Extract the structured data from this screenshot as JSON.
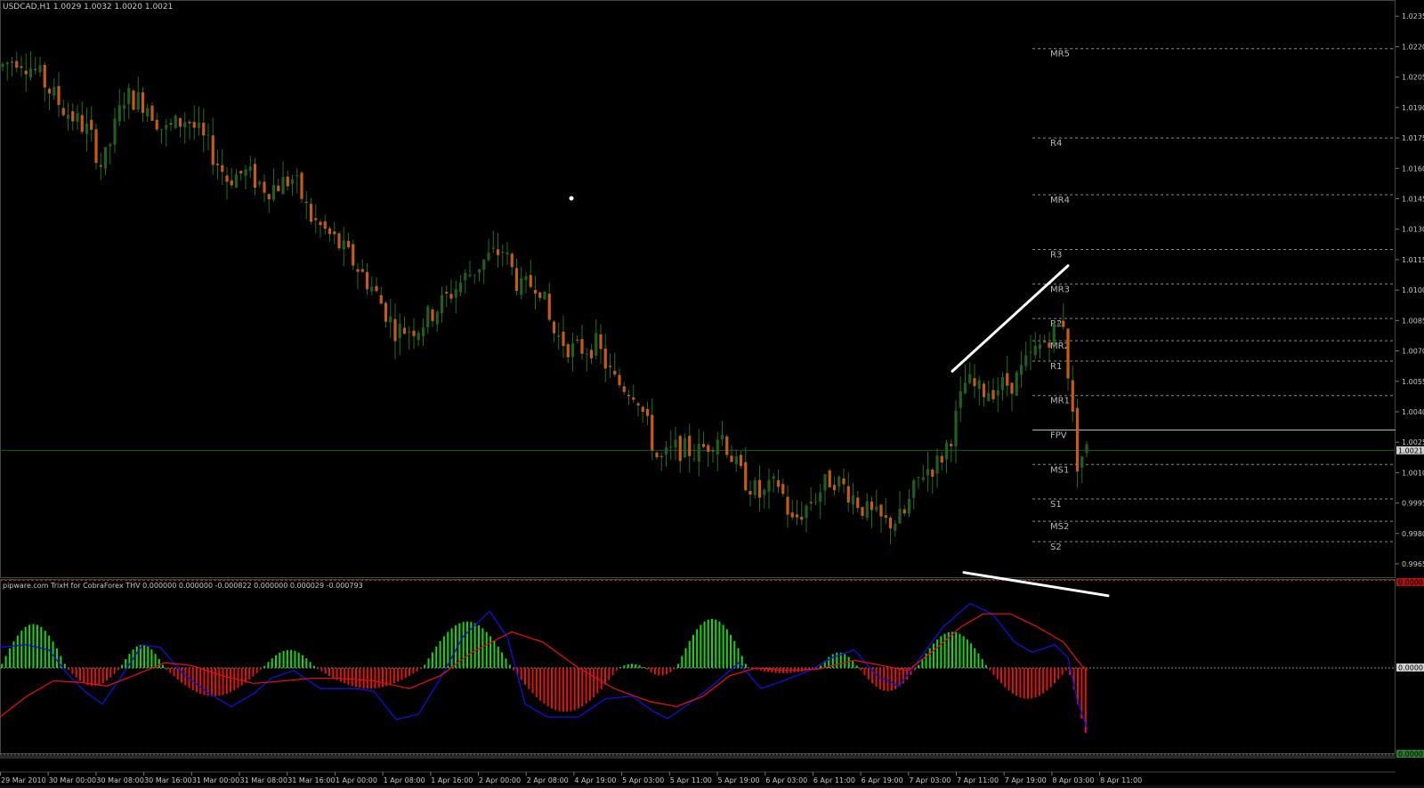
{
  "main_chart": {
    "symbol_header": "USDCAD,H1  1.0029 1.0032 1.0020 1.0021",
    "current_price_label": "1.0021",
    "price_scale": [
      "1.0235",
      "1.0220",
      "1.0205",
      "1.0190",
      "1.0175",
      "1.0160",
      "1.0145",
      "1.0130",
      "1.0115",
      "1.0100",
      "1.0085",
      "1.0070",
      "1.0055",
      "1.0040",
      "1.0025",
      "1.0010",
      "0.9995",
      "0.9980",
      "0.9965"
    ],
    "pivot_levels": [
      {
        "label": "MR5",
        "price": 1.0219
      },
      {
        "label": "R4",
        "price": 1.0175
      },
      {
        "label": "MR4",
        "price": 1.0147
      },
      {
        "label": "R3",
        "price": 1.012
      },
      {
        "label": "MR3",
        "price": 1.0103
      },
      {
        "label": "R2",
        "price": 1.0086
      },
      {
        "label": "MR2",
        "price": 1.0075
      },
      {
        "label": "R1",
        "price": 1.0065
      },
      {
        "label": "MR1",
        "price": 1.0048
      },
      {
        "label": "FPV",
        "price": 1.0031
      },
      {
        "label": "MS1",
        "price": 1.0014
      },
      {
        "label": "S1",
        "price": 0.9997
      },
      {
        "label": "MS2",
        "price": 0.9986
      },
      {
        "label": "S2",
        "price": 0.9976
      }
    ]
  },
  "indicator": {
    "header": "pipware.com TrixH for CobraForex THV 0.000000 0.000000 -0.000822 0.000000 0.000029 -0.000793",
    "zero_label": "0.0000",
    "top_label": "0.0000",
    "bottom_label": "0.0000"
  },
  "time_axis": [
    "29 Mar 2010",
    "30 Mar 00:00",
    "30 Mar 08:00",
    "30 Mar 16:00",
    "31 Mar 00:00",
    "31 Mar 08:00",
    "31 Mar 16:00",
    "1 Apr 00:00",
    "1 Apr 08:00",
    "1 Apr 16:00",
    "2 Apr 00:00",
    "2 Apr 08:00",
    "4 Apr 19:00",
    "5 Apr 03:00",
    "5 Apr 11:00",
    "5 Apr 19:00",
    "6 Apr 03:00",
    "6 Apr 11:00",
    "6 Apr 19:00",
    "7 Apr 03:00",
    "7 Apr 11:00",
    "7 Apr 19:00",
    "8 Apr 03:00",
    "8 Apr 11:00"
  ],
  "chart_data": {
    "type": "candlestick",
    "symbol": "USDCAD",
    "timeframe": "H1",
    "last_bar": {
      "open": 1.0029,
      "high": 1.0032,
      "low": 1.002,
      "close": 1.0021
    },
    "y_range": [
      0.9958,
      1.0243
    ],
    "close_path": [
      [
        0,
        1.021
      ],
      [
        20,
        1.0215
      ],
      [
        40,
        1.0208
      ],
      [
        70,
        1.019
      ],
      [
        100,
        1.0178
      ],
      [
        115,
        1.016
      ],
      [
        140,
        1.0196
      ],
      [
        165,
        1.0192
      ],
      [
        185,
        1.0178
      ],
      [
        210,
        1.0185
      ],
      [
        235,
        1.017
      ],
      [
        255,
        1.0155
      ],
      [
        275,
        1.0158
      ],
      [
        300,
        1.015
      ],
      [
        330,
        1.0155
      ],
      [
        350,
        1.0135
      ],
      [
        375,
        1.0125
      ],
      [
        395,
        1.0115
      ],
      [
        420,
        1.01
      ],
      [
        445,
        1.008
      ],
      [
        470,
        1.0082
      ],
      [
        495,
        1.0093
      ],
      [
        520,
        1.0105
      ],
      [
        545,
        1.0115
      ],
      [
        565,
        1.012
      ],
      [
        585,
        1.01
      ],
      [
        605,
        1.0105
      ],
      [
        620,
        1.008
      ],
      [
        645,
        1.007
      ],
      [
        670,
        1.0073
      ],
      [
        690,
        1.0055
      ],
      [
        715,
        1.005
      ],
      [
        740,
        1.0015
      ],
      [
        760,
        1.0022
      ],
      [
        785,
        1.002
      ],
      [
        810,
        1.003
      ],
      [
        830,
        1.001
      ],
      [
        855,
        0.9998
      ],
      [
        875,
        1.0005
      ],
      [
        890,
        0.9985
      ],
      [
        915,
        0.9998
      ],
      [
        935,
        1.0008
      ],
      [
        955,
        1.0
      ],
      [
        975,
        0.999
      ],
      [
        995,
        0.9985
      ],
      [
        1015,
        0.9988
      ],
      [
        1035,
        1.001
      ],
      [
        1055,
        1.0015
      ],
      [
        1070,
        1.003
      ],
      [
        1085,
        1.0055
      ],
      [
        1100,
        1.005
      ],
      [
        1120,
        1.0052
      ],
      [
        1140,
        1.0055
      ],
      [
        1160,
        1.0068
      ],
      [
        1180,
        1.0078
      ],
      [
        1195,
        1.0085
      ],
      [
        1200,
        1.006
      ],
      [
        1210,
        1.0015
      ],
      [
        1220,
        1.0021
      ]
    ],
    "trendlines": [
      {
        "from": [
          1070,
          1.006
        ],
        "to": [
          1200,
          1.0112
        ]
      }
    ],
    "indicator_bars": [
      {
        "from": 0,
        "to": 75,
        "peak": 0.85,
        "sign": "positive"
      },
      {
        "from": 75,
        "to": 135,
        "peak": -0.35,
        "sign": "negative"
      },
      {
        "from": 135,
        "to": 185,
        "peak": 0.45,
        "sign": "positive"
      },
      {
        "from": 185,
        "to": 295,
        "peak": -0.55,
        "sign": "negative"
      },
      {
        "from": 295,
        "to": 355,
        "peak": 0.35,
        "sign": "positive"
      },
      {
        "from": 355,
        "to": 475,
        "peak": -0.4,
        "sign": "negative"
      },
      {
        "from": 475,
        "to": 575,
        "peak": 0.9,
        "sign": "positive"
      },
      {
        "from": 575,
        "to": 695,
        "peak": -0.85,
        "sign": "negative"
      },
      {
        "from": 695,
        "to": 725,
        "peak": 0.08,
        "sign": "positive"
      },
      {
        "from": 725,
        "to": 760,
        "peak": -0.15,
        "sign": "negative"
      },
      {
        "from": 760,
        "to": 840,
        "peak": 0.95,
        "sign": "positive"
      },
      {
        "from": 840,
        "to": 920,
        "peak": -0.1,
        "sign": "negative"
      },
      {
        "from": 920,
        "to": 965,
        "peak": 0.3,
        "sign": "positive"
      },
      {
        "from": 965,
        "to": 1030,
        "peak": -0.45,
        "sign": "negative"
      },
      {
        "from": 1030,
        "to": 1110,
        "peak": 0.7,
        "sign": "positive"
      },
      {
        "from": 1110,
        "to": 1200,
        "peak": -0.6,
        "sign": "negative"
      },
      {
        "from": 1200,
        "to": 1222,
        "peak": -1.4,
        "sign": "negative"
      }
    ],
    "indicator_lines": [
      {
        "color": "#1010dd",
        "points": [
          [
            0,
            0.4
          ],
          [
            30,
            0.45
          ],
          [
            55,
            0.35
          ],
          [
            75,
            -0.1
          ],
          [
            95,
            -0.45
          ],
          [
            115,
            -0.7
          ],
          [
            135,
            -0.2
          ],
          [
            160,
            0.45
          ],
          [
            180,
            0.4
          ],
          [
            205,
            -0.1
          ],
          [
            235,
            -0.5
          ],
          [
            260,
            -0.75
          ],
          [
            285,
            -0.5
          ],
          [
            305,
            -0.2
          ],
          [
            330,
            -0.05
          ],
          [
            360,
            -0.4
          ],
          [
            400,
            -0.4
          ],
          [
            420,
            -0.45
          ],
          [
            445,
            -1.0
          ],
          [
            470,
            -0.9
          ],
          [
            495,
            -0.2
          ],
          [
            520,
            0.6
          ],
          [
            550,
            1.1
          ],
          [
            570,
            0.6
          ],
          [
            590,
            -0.7
          ],
          [
            615,
            -0.95
          ],
          [
            650,
            -0.95
          ],
          [
            680,
            -0.6
          ],
          [
            710,
            -0.55
          ],
          [
            735,
            -0.85
          ],
          [
            750,
            -0.98
          ],
          [
            770,
            -0.75
          ],
          [
            800,
            -0.35
          ],
          [
            830,
            0.1
          ],
          [
            855,
            -0.4
          ],
          [
            880,
            -0.25
          ],
          [
            910,
            -0.05
          ],
          [
            935,
            0.2
          ],
          [
            960,
            0.35
          ],
          [
            985,
            -0.15
          ],
          [
            1010,
            -0.35
          ],
          [
            1030,
            0.1
          ],
          [
            1060,
            0.8
          ],
          [
            1090,
            1.25
          ],
          [
            1115,
            1.05
          ],
          [
            1140,
            0.5
          ],
          [
            1160,
            0.3
          ],
          [
            1185,
            0.45
          ],
          [
            1200,
            0.2
          ],
          [
            1210,
            -0.6
          ],
          [
            1222,
            -1.2
          ]
        ]
      },
      {
        "color": "#dd1010",
        "points": [
          [
            0,
            -0.95
          ],
          [
            30,
            -0.55
          ],
          [
            60,
            -0.25
          ],
          [
            90,
            -0.28
          ],
          [
            120,
            -0.35
          ],
          [
            150,
            -0.15
          ],
          [
            185,
            0.1
          ],
          [
            215,
            0.05
          ],
          [
            250,
            -0.15
          ],
          [
            285,
            -0.3
          ],
          [
            320,
            -0.25
          ],
          [
            350,
            -0.2
          ],
          [
            380,
            -0.2
          ],
          [
            420,
            -0.25
          ],
          [
            460,
            -0.4
          ],
          [
            495,
            -0.15
          ],
          [
            530,
            0.3
          ],
          [
            575,
            0.7
          ],
          [
            610,
            0.5
          ],
          [
            650,
            0.0
          ],
          [
            690,
            -0.4
          ],
          [
            730,
            -0.65
          ],
          [
            760,
            -0.75
          ],
          [
            790,
            -0.55
          ],
          [
            820,
            -0.15
          ],
          [
            850,
            0.0
          ],
          [
            880,
            -0.05
          ],
          [
            920,
            -0.02
          ],
          [
            960,
            0.15
          ],
          [
            990,
            0.05
          ],
          [
            1020,
            -0.05
          ],
          [
            1050,
            0.35
          ],
          [
            1080,
            0.8
          ],
          [
            1105,
            1.05
          ],
          [
            1135,
            1.05
          ],
          [
            1165,
            0.8
          ],
          [
            1195,
            0.5
          ],
          [
            1215,
            0.05
          ],
          [
            1222,
            -0.05
          ]
        ]
      }
    ],
    "indicator_trendline": {
      "from": [
        1083,
        1.85
      ],
      "to": [
        1245,
        1.4
      ]
    }
  }
}
